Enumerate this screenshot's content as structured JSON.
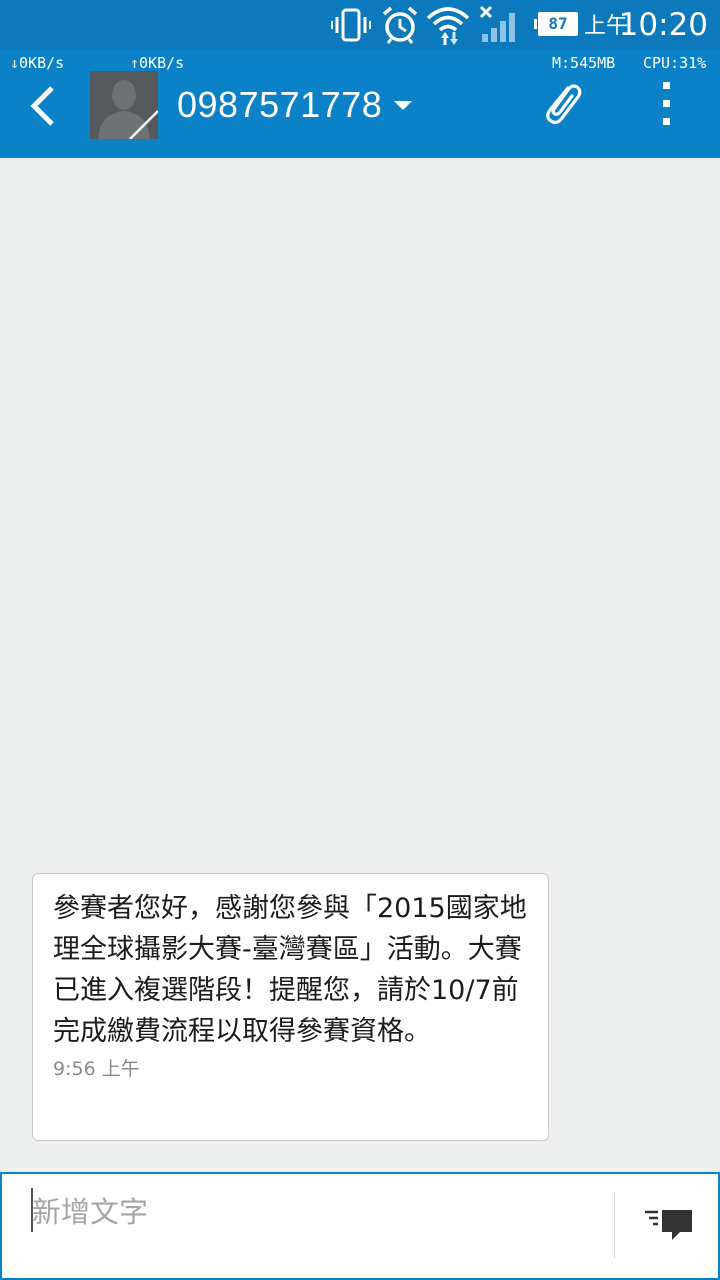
{
  "status_bar": {
    "battery_level": "87",
    "ampm": "上午",
    "time": "10:20",
    "icons": [
      "vibrate-icon",
      "alarm-icon",
      "wifi-icon",
      "signal-icon",
      "battery-icon"
    ]
  },
  "toolbar": {
    "download_speed": "↓0KB/s",
    "upload_speed": "↑0KB/s",
    "memory": "M:545MB",
    "cpu": "CPU:31%",
    "contact_name": "0987571778",
    "icons": [
      "back-icon",
      "avatar",
      "caret-down-icon",
      "paperclip-icon",
      "more-vert-icon"
    ]
  },
  "conversation": {
    "messages": [
      {
        "text": "參賽者您好，感謝您參與「2015國家地理全球攝影大賽-臺灣賽區」活動。大賽已進入複選階段！提醒您，請於10/7前完成繳費流程以取得參賽資格。",
        "time": "9:56 上午"
      }
    ]
  },
  "composer": {
    "placeholder": "新增文字",
    "value": "",
    "send_icon": "send-message-icon"
  },
  "colors": {
    "status_bar": "#0c79bd",
    "toolbar": "#0b82c8",
    "background": "#eef0f0",
    "bubble": "#ffffff",
    "composer_border": "#0b82c8"
  }
}
